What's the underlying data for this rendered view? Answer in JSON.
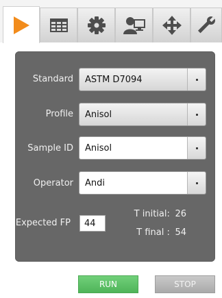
{
  "tabs": [
    {
      "icon": "play-icon",
      "active": true
    },
    {
      "icon": "table-icon",
      "active": false
    },
    {
      "icon": "gear-icon",
      "active": false
    },
    {
      "icon": "user-monitor-icon",
      "active": false
    },
    {
      "icon": "move-icon",
      "active": false
    },
    {
      "icon": "wrench-icon",
      "active": false
    }
  ],
  "form": {
    "standard": {
      "label": "Standard",
      "value": "ASTM D7094"
    },
    "profile": {
      "label": "Profile",
      "value": "Anisol"
    },
    "sample_id": {
      "label": "Sample ID",
      "value": "Anisol"
    },
    "operator": {
      "label": "Operator",
      "value": "Andi"
    },
    "expected_fp": {
      "label": "Expected FP",
      "value": "44"
    },
    "t_initial": {
      "label": "T initial:",
      "value": "26"
    },
    "t_final": {
      "label": "T final :",
      "value": "54"
    }
  },
  "buttons": {
    "run": "RUN",
    "stop": "STOP"
  },
  "colors": {
    "accent_orange": "#f28c1c",
    "run_green": "#5bbf64",
    "panel_grey": "#676767"
  }
}
